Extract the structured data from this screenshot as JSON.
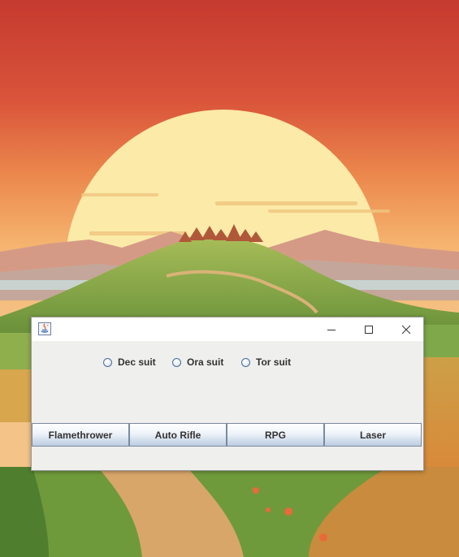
{
  "window": {
    "title": "",
    "controls": {
      "minimize": "minimize-icon",
      "maximize": "maximize-icon",
      "close": "close-icon"
    }
  },
  "suits": [
    {
      "label": "Dec suit",
      "selected": false
    },
    {
      "label": "Ora suit",
      "selected": false
    },
    {
      "label": "Tor suit",
      "selected": false
    }
  ],
  "weapons": [
    {
      "label": "Flamethrower"
    },
    {
      "label": "Auto Rifle"
    },
    {
      "label": "RPG"
    },
    {
      "label": "Laser"
    }
  ],
  "colors": {
    "window_bg": "#efefed",
    "titlebar_bg": "#ffffff",
    "sky_top": "#c53a2f",
    "sun": "#fbeaa8"
  }
}
